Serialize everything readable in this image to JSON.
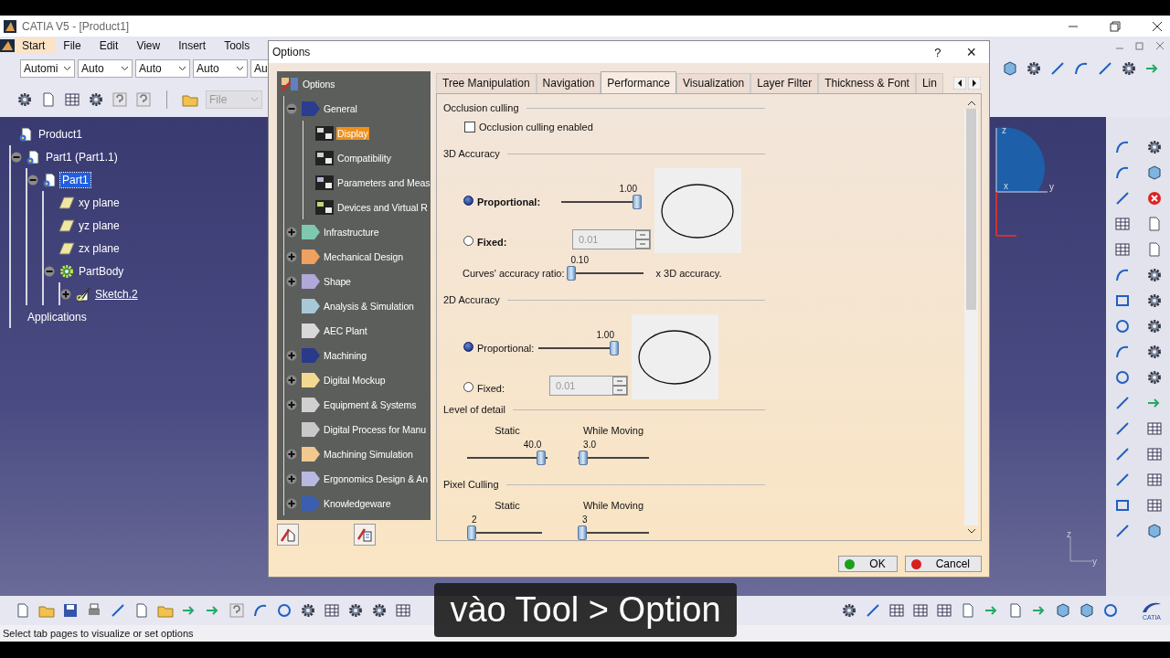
{
  "window": {
    "title": "CATIA V5 - [Product1]"
  },
  "menu": [
    {
      "label": "Start",
      "selected": true
    },
    {
      "label": "File",
      "selected": false
    },
    {
      "label": "Edit",
      "selected": false
    },
    {
      "label": "View",
      "selected": false
    },
    {
      "label": "Insert",
      "selected": false
    },
    {
      "label": "Tools",
      "selected": false
    }
  ],
  "toolbar": {
    "dropdowns": [
      {
        "value": "Automi"
      },
      {
        "value": "Auto"
      },
      {
        "value": "Auto"
      },
      {
        "value": "Auto"
      },
      {
        "value": "Au"
      }
    ],
    "file_dropdown": {
      "value": "File",
      "disabled": true
    }
  },
  "spec_tree": [
    {
      "kind": "product",
      "label": "Product1",
      "selected": false,
      "in_work": false,
      "children": [
        {
          "kind": "part",
          "label": "Part1 (Part1.1)",
          "expanded": true,
          "selected": false,
          "in_work": false,
          "children": [
            {
              "kind": "part",
              "label": "Part1",
              "expanded": true,
              "selected": true,
              "in_work": false,
              "children": [
                {
                  "kind": "plane",
                  "label": "xy plane",
                  "selected": false,
                  "in_work": false
                },
                {
                  "kind": "plane",
                  "label": "yz plane",
                  "selected": false,
                  "in_work": false
                },
                {
                  "kind": "plane",
                  "label": "zx plane",
                  "selected": false,
                  "in_work": false
                },
                {
                  "kind": "body",
                  "label": "PartBody",
                  "expanded": true,
                  "selected": false,
                  "in_work": false,
                  "children": [
                    {
                      "kind": "sketch",
                      "label": "Sketch.2",
                      "expanded": false,
                      "selected": false,
                      "in_work": true
                    }
                  ]
                }
              ]
            }
          ]
        },
        {
          "kind": "label",
          "label": "Applications",
          "selected": false,
          "in_work": false
        }
      ]
    }
  ],
  "viewport": {
    "sketch_axes": [
      "z",
      "x",
      "y"
    ],
    "corner_axes": [
      "z",
      "y"
    ]
  },
  "dialog": {
    "title": "Options",
    "help": "?",
    "close": "×",
    "tree": [
      {
        "kind": "root",
        "label": "Options",
        "selected": false,
        "children": [
          {
            "kind": "category",
            "label": "General",
            "expanded": true,
            "selected": false,
            "children": [
              {
                "kind": "page",
                "label": "Display",
                "selected": true
              },
              {
                "kind": "page",
                "label": "Compatibility",
                "selected": false
              },
              {
                "kind": "page",
                "label": "Parameters and Meas",
                "selected": false
              },
              {
                "kind": "page",
                "label": "Devices and Virtual R",
                "selected": false
              }
            ]
          },
          {
            "kind": "category",
            "label": "Infrastructure",
            "expanded": false,
            "selected": false
          },
          {
            "kind": "category",
            "label": "Mechanical Design",
            "expanded": false,
            "selected": false
          },
          {
            "kind": "category",
            "label": "Shape",
            "expanded": false,
            "selected": false
          },
          {
            "kind": "category",
            "label": "Analysis & Simulation",
            "selected": false
          },
          {
            "kind": "category",
            "label": "AEC Plant",
            "selected": false
          },
          {
            "kind": "category",
            "label": "Machining",
            "expanded": false,
            "selected": false
          },
          {
            "kind": "category",
            "label": "Digital Mockup",
            "expanded": false,
            "selected": false
          },
          {
            "kind": "category",
            "label": "Equipment & Systems",
            "expanded": false,
            "selected": false
          },
          {
            "kind": "category",
            "label": "Digital Process for Manu",
            "selected": false
          },
          {
            "kind": "category",
            "label": "Machining Simulation",
            "expanded": false,
            "selected": false
          },
          {
            "kind": "category",
            "label": "Ergonomics Design & An",
            "expanded": false,
            "selected": false
          },
          {
            "kind": "category",
            "label": "Knowledgeware",
            "expanded": false,
            "selected": false
          }
        ]
      }
    ],
    "tabs": [
      {
        "label": "Tree Manipulation",
        "selected": false
      },
      {
        "label": "Navigation",
        "selected": false
      },
      {
        "label": "Performance",
        "selected": true
      },
      {
        "label": "Visualization",
        "selected": false
      },
      {
        "label": "Layer Filter",
        "selected": false
      },
      {
        "label": "Thickness & Font",
        "selected": false
      },
      {
        "label": "Lin",
        "selected": false
      }
    ],
    "sections": [
      {
        "kind": "checkbox",
        "title": "Occlusion culling",
        "checkbox": {
          "label": "Occlusion culling enabled",
          "checked": false
        }
      },
      {
        "kind": "accuracy",
        "title": "3D Accuracy",
        "focused": true,
        "proportional": {
          "label": "Proportional:",
          "selected": true,
          "level": 1,
          "reading": "1.00"
        },
        "fixed": {
          "label": "Fixed:",
          "selected": false,
          "value": "0.01",
          "disabled": true
        },
        "ratio": {
          "label": "Curves' accuracy ratio:",
          "level": 0,
          "reading": "0.10",
          "suffix": "x 3D accuracy."
        }
      },
      {
        "kind": "accuracy",
        "title": "2D Accuracy",
        "focused": false,
        "proportional": {
          "label": "Proportional:",
          "selected": true,
          "level": 1,
          "reading": "1.00"
        },
        "fixed": {
          "label": "Fixed:",
          "selected": false,
          "value": "0.01",
          "disabled": true
        }
      },
      {
        "kind": "sliders",
        "title": "Level of detail",
        "sliders": [
          {
            "label": "Static",
            "level": 0.97,
            "reading": "40.0"
          },
          {
            "label": "While Moving",
            "level": 0.02,
            "reading": "3.0"
          }
        ]
      },
      {
        "kind": "sliders",
        "title": "Pixel Culling",
        "sliders": [
          {
            "label": "Static",
            "level": 0,
            "reading": "2"
          },
          {
            "label": "While Moving",
            "level": 0,
            "reading": "3"
          }
        ]
      }
    ],
    "buttons": [
      {
        "kind": "ok",
        "label": "OK"
      },
      {
        "kind": "cancel",
        "label": "Cancel"
      }
    ]
  },
  "status_bar": "Select tab pages to visualize or set options",
  "logo_text": "CATIA",
  "subtitle": "vào Tool > Option"
}
